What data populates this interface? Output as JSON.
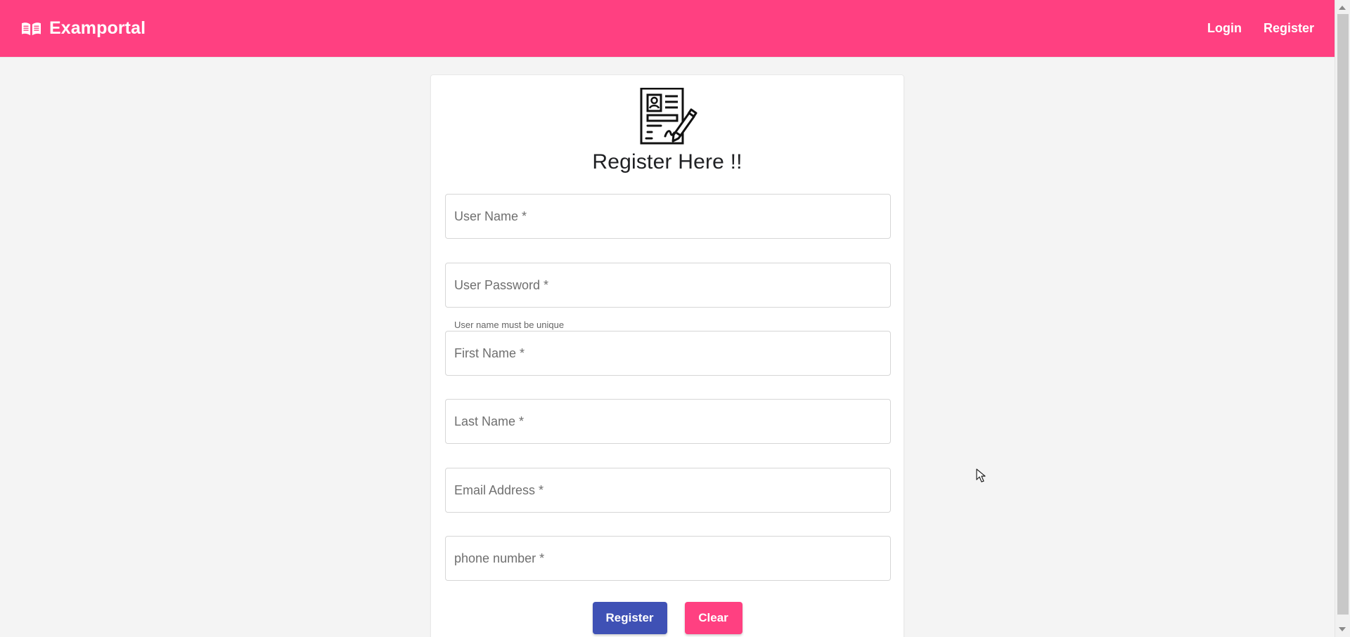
{
  "header": {
    "brand_icon": "book-open-icon",
    "brand": "Examportal",
    "nav": {
      "login": "Login",
      "register": "Register"
    },
    "color": "#ff4081"
  },
  "form": {
    "icon": "registration-form-icon",
    "title": "Register Here !!",
    "fields": {
      "username": {
        "placeholder": "User Name *",
        "value": "",
        "hint": "User name must be unique"
      },
      "password": {
        "placeholder": "User Password *",
        "value": ""
      },
      "first_name": {
        "placeholder": "First Name *",
        "value": ""
      },
      "last_name": {
        "placeholder": "Last Name *",
        "value": ""
      },
      "email": {
        "placeholder": "Email Address *",
        "value": ""
      },
      "phone": {
        "placeholder": "phone number *",
        "value": ""
      }
    },
    "actions": {
      "register": "Register",
      "clear": "Clear"
    },
    "button_colors": {
      "register": "#3f51b5",
      "clear": "#ff4081"
    }
  }
}
